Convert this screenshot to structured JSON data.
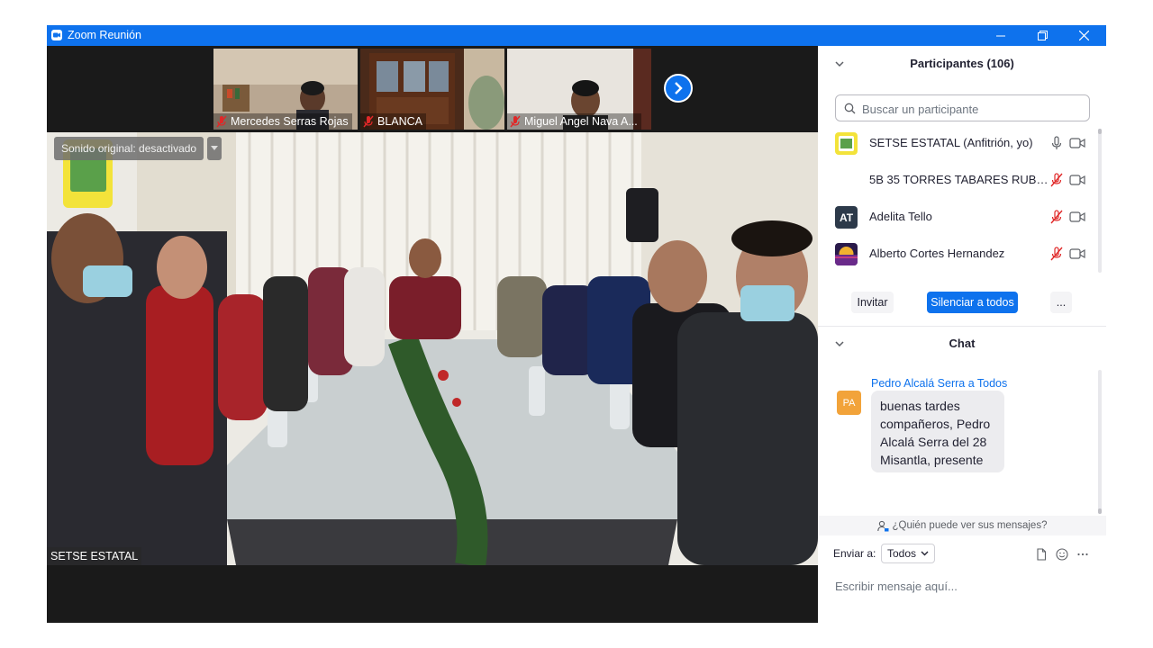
{
  "window": {
    "title": "Zoom Reunión",
    "accent": "#0e72ed"
  },
  "thumbnails": [
    {
      "name": "Mercedes Serras Rojas",
      "muted": true
    },
    {
      "name": "BLANCA",
      "muted": true
    },
    {
      "name": "Miguel Angel Nava A...",
      "muted": true
    }
  ],
  "main_video": {
    "audio_status": "Sonido original: desactivado",
    "speaker_name": "SETSE ESTATAL"
  },
  "participants": {
    "title": "Participantes (106)",
    "search_placeholder": "Buscar un participante",
    "list": [
      {
        "name": "SETSE ESTATAL (Anfitrión, yo)",
        "avatar": "logo",
        "mic": "on"
      },
      {
        "name": "5B 35 TORRES TABARES RUBEN ...",
        "avatar": "none",
        "mic": "muted"
      },
      {
        "name": "Adelita Tello",
        "avatar": "AT",
        "mic": "muted"
      },
      {
        "name": "Alberto Cortes Hernandez",
        "avatar": "image",
        "mic": "muted"
      }
    ],
    "buttons": {
      "invite": "Invitar",
      "mute_all": "Silenciar a todos",
      "more": "..."
    }
  },
  "chat": {
    "title": "Chat",
    "messages": [
      {
        "from": "Pedro Alcalá Serra a Todos",
        "avatar_initials": "PA",
        "avatar_color": "#f2a33a",
        "lines": [
          "buenas tardes",
          "compañeros, Pedro",
          "Alcalá Serra del 28",
          "Misantla, presente"
        ]
      }
    ],
    "who_can_see": "¿Quién puede ver sus mensajes?",
    "send_to_label": "Enviar a:",
    "send_to_value": "Todos",
    "input_placeholder": "Escribir mensaje aquí..."
  }
}
